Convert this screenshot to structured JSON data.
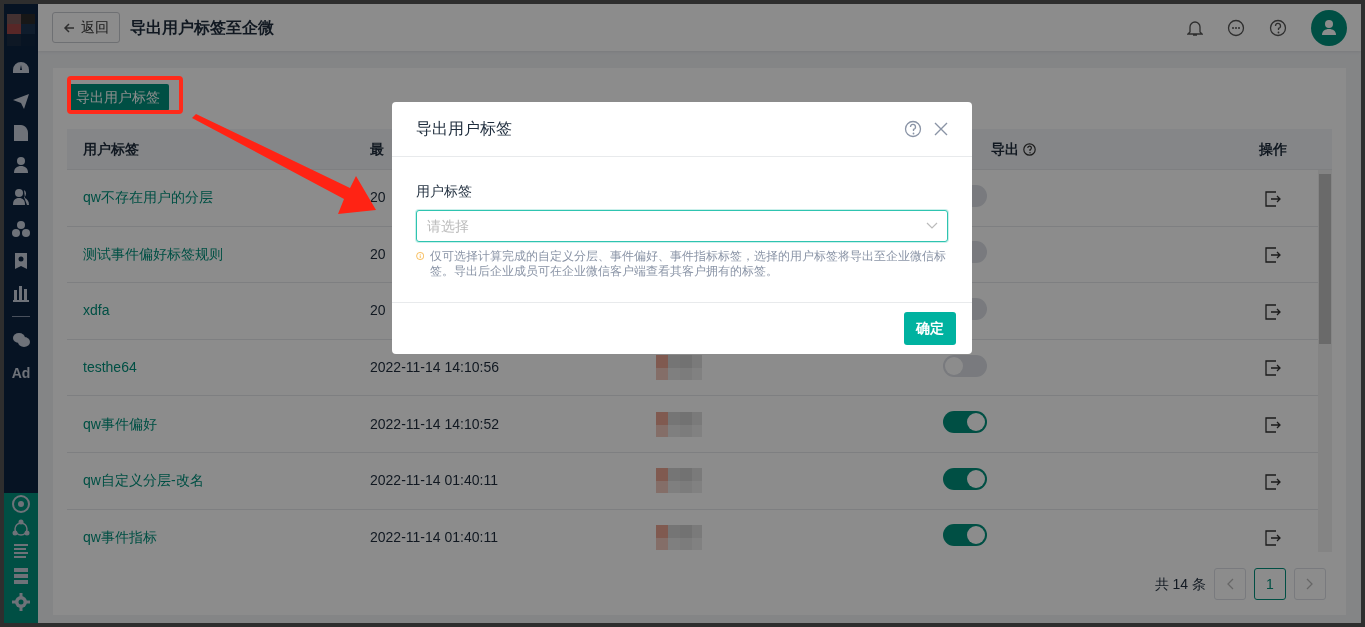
{
  "sidebar": {
    "ad_label": "Ad"
  },
  "header": {
    "back_label": "返回",
    "title": "导出用户标签至企微"
  },
  "toolbar": {
    "export_button": "导出用户标签"
  },
  "table": {
    "columns": [
      "用户标签",
      "最",
      "导出",
      "操作"
    ],
    "rows": [
      {
        "tag": "qw不存在用户的分层",
        "time": "20",
        "exported": false
      },
      {
        "tag": "测试事件偏好标签规则",
        "time": "20",
        "exported": false
      },
      {
        "tag": "xdfa",
        "time": "20",
        "exported": false
      },
      {
        "tag": "testhe64",
        "time": "2022-11-14 14:10:56",
        "thumbnail": true,
        "exported": false
      },
      {
        "tag": "qw事件偏好",
        "time": "2022-11-14 14:10:52",
        "thumbnail": true,
        "exported": true
      },
      {
        "tag": "qw自定义分层-改名",
        "time": "2022-11-14 01:40:11",
        "thumbnail": true,
        "exported": true
      },
      {
        "tag": "qw事件指标",
        "time": "2022-11-14 01:40:11",
        "thumbnail": true,
        "exported": true
      }
    ]
  },
  "pagination": {
    "total": "共 14 条",
    "pages": [
      {
        "label": "1",
        "selected": true
      }
    ]
  },
  "modal": {
    "title": "导出用户标签",
    "field_label": "用户标签",
    "placeholder": "请选择",
    "hint": "仅可选择计算完成的自定义分层、事件偏好、事件指标标签，选择的用户标签将导出至企业微信标签。导出后企业成员可在企业微信客户端查看其客户拥有的标签。",
    "confirm": "确定"
  }
}
